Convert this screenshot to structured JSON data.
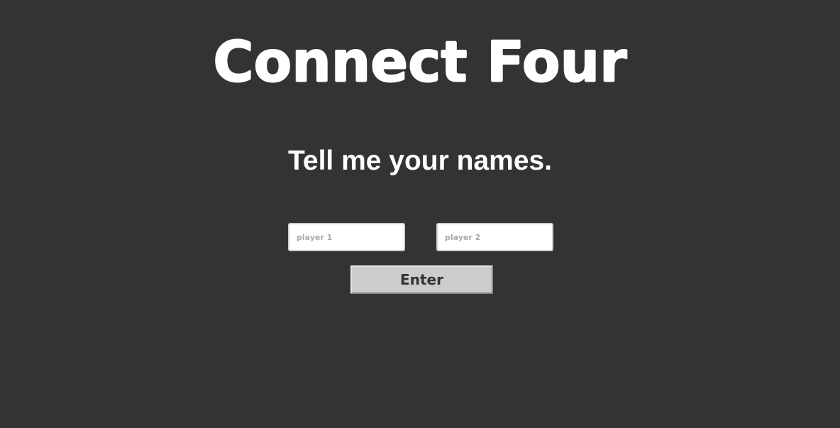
{
  "app": {
    "title": "Connect Four"
  },
  "prompt": {
    "text": "Tell me your names."
  },
  "form": {
    "player1_placeholder": "player 1",
    "player1_value": "",
    "player2_placeholder": "player 2",
    "player2_value": "",
    "enter_label": "Enter"
  },
  "colors": {
    "background": "#333333",
    "text": "#ffffff",
    "button_bg": "#cccccc",
    "button_text": "#333333"
  }
}
